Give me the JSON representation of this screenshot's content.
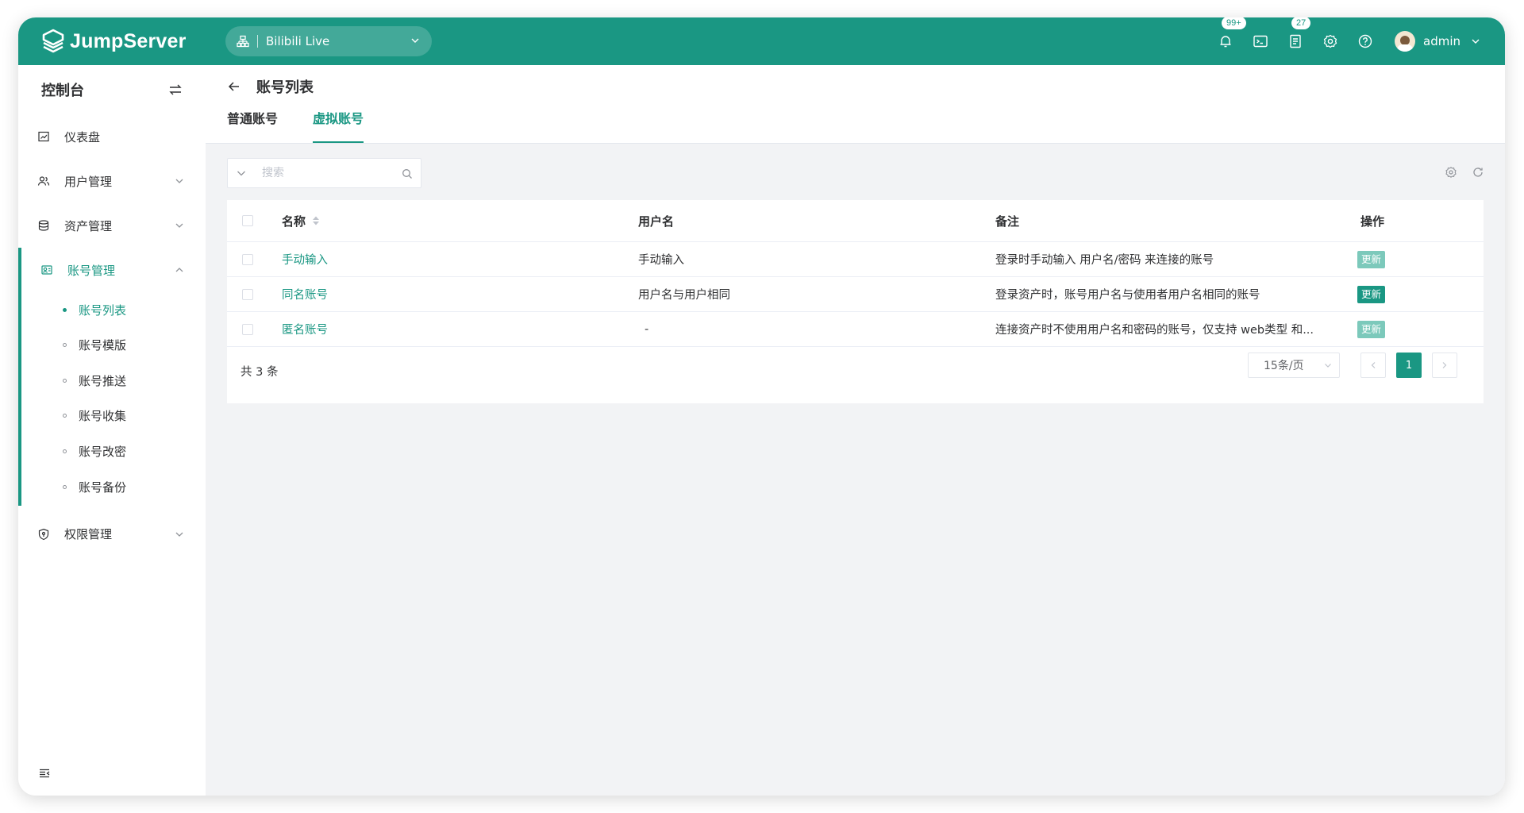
{
  "app": {
    "brand": "JumpServer",
    "accent": "#1a9783"
  },
  "topbar": {
    "org": "Bilibili Live",
    "notifications_badge": "99+",
    "tickets_badge": "27",
    "user": "admin",
    "icons": [
      "bell-icon",
      "terminal-icon",
      "ticket-icon",
      "gear-icon",
      "help-icon"
    ]
  },
  "sidebar": {
    "title": "控制台",
    "items": [
      {
        "label": "仪表盘",
        "icon": "dashboard-icon"
      },
      {
        "label": "用户管理",
        "icon": "users-icon"
      },
      {
        "label": "资产管理",
        "icon": "assets-icon"
      },
      {
        "label": "账号管理",
        "icon": "accounts-icon",
        "expanded": true
      },
      {
        "label": "权限管理",
        "icon": "permission-icon"
      }
    ],
    "sub_items": [
      {
        "label": "账号列表",
        "active": true
      },
      {
        "label": "账号模版"
      },
      {
        "label": "账号推送"
      },
      {
        "label": "账号收集"
      },
      {
        "label": "账号改密"
      },
      {
        "label": "账号备份"
      }
    ]
  },
  "page": {
    "title": "账号列表",
    "tabs": [
      "普通账号",
      "虚拟账号"
    ],
    "active_tab": "虚拟账号"
  },
  "search": {
    "placeholder": "搜索"
  },
  "table": {
    "columns": [
      "名称",
      "用户名",
      "备注",
      "操作"
    ],
    "rows": [
      {
        "name": "手动输入",
        "username": "手动输入",
        "note": "登录时手动输入 用户名/密码 来连接的账号",
        "action": "更新"
      },
      {
        "name": "同名账号",
        "username": "用户名与用户相同",
        "note": "登录资产时，账号用户名与使用者用户名相同的账号",
        "action": "更新"
      },
      {
        "name": "匿名账号",
        "username": "-",
        "note": "连接资产时不使用用户名和密码的账号，仅支持 web类型 和...",
        "action": "更新"
      }
    ]
  },
  "footer": {
    "total": "共 3 条",
    "page_size": "15条/页",
    "current_page": "1"
  }
}
